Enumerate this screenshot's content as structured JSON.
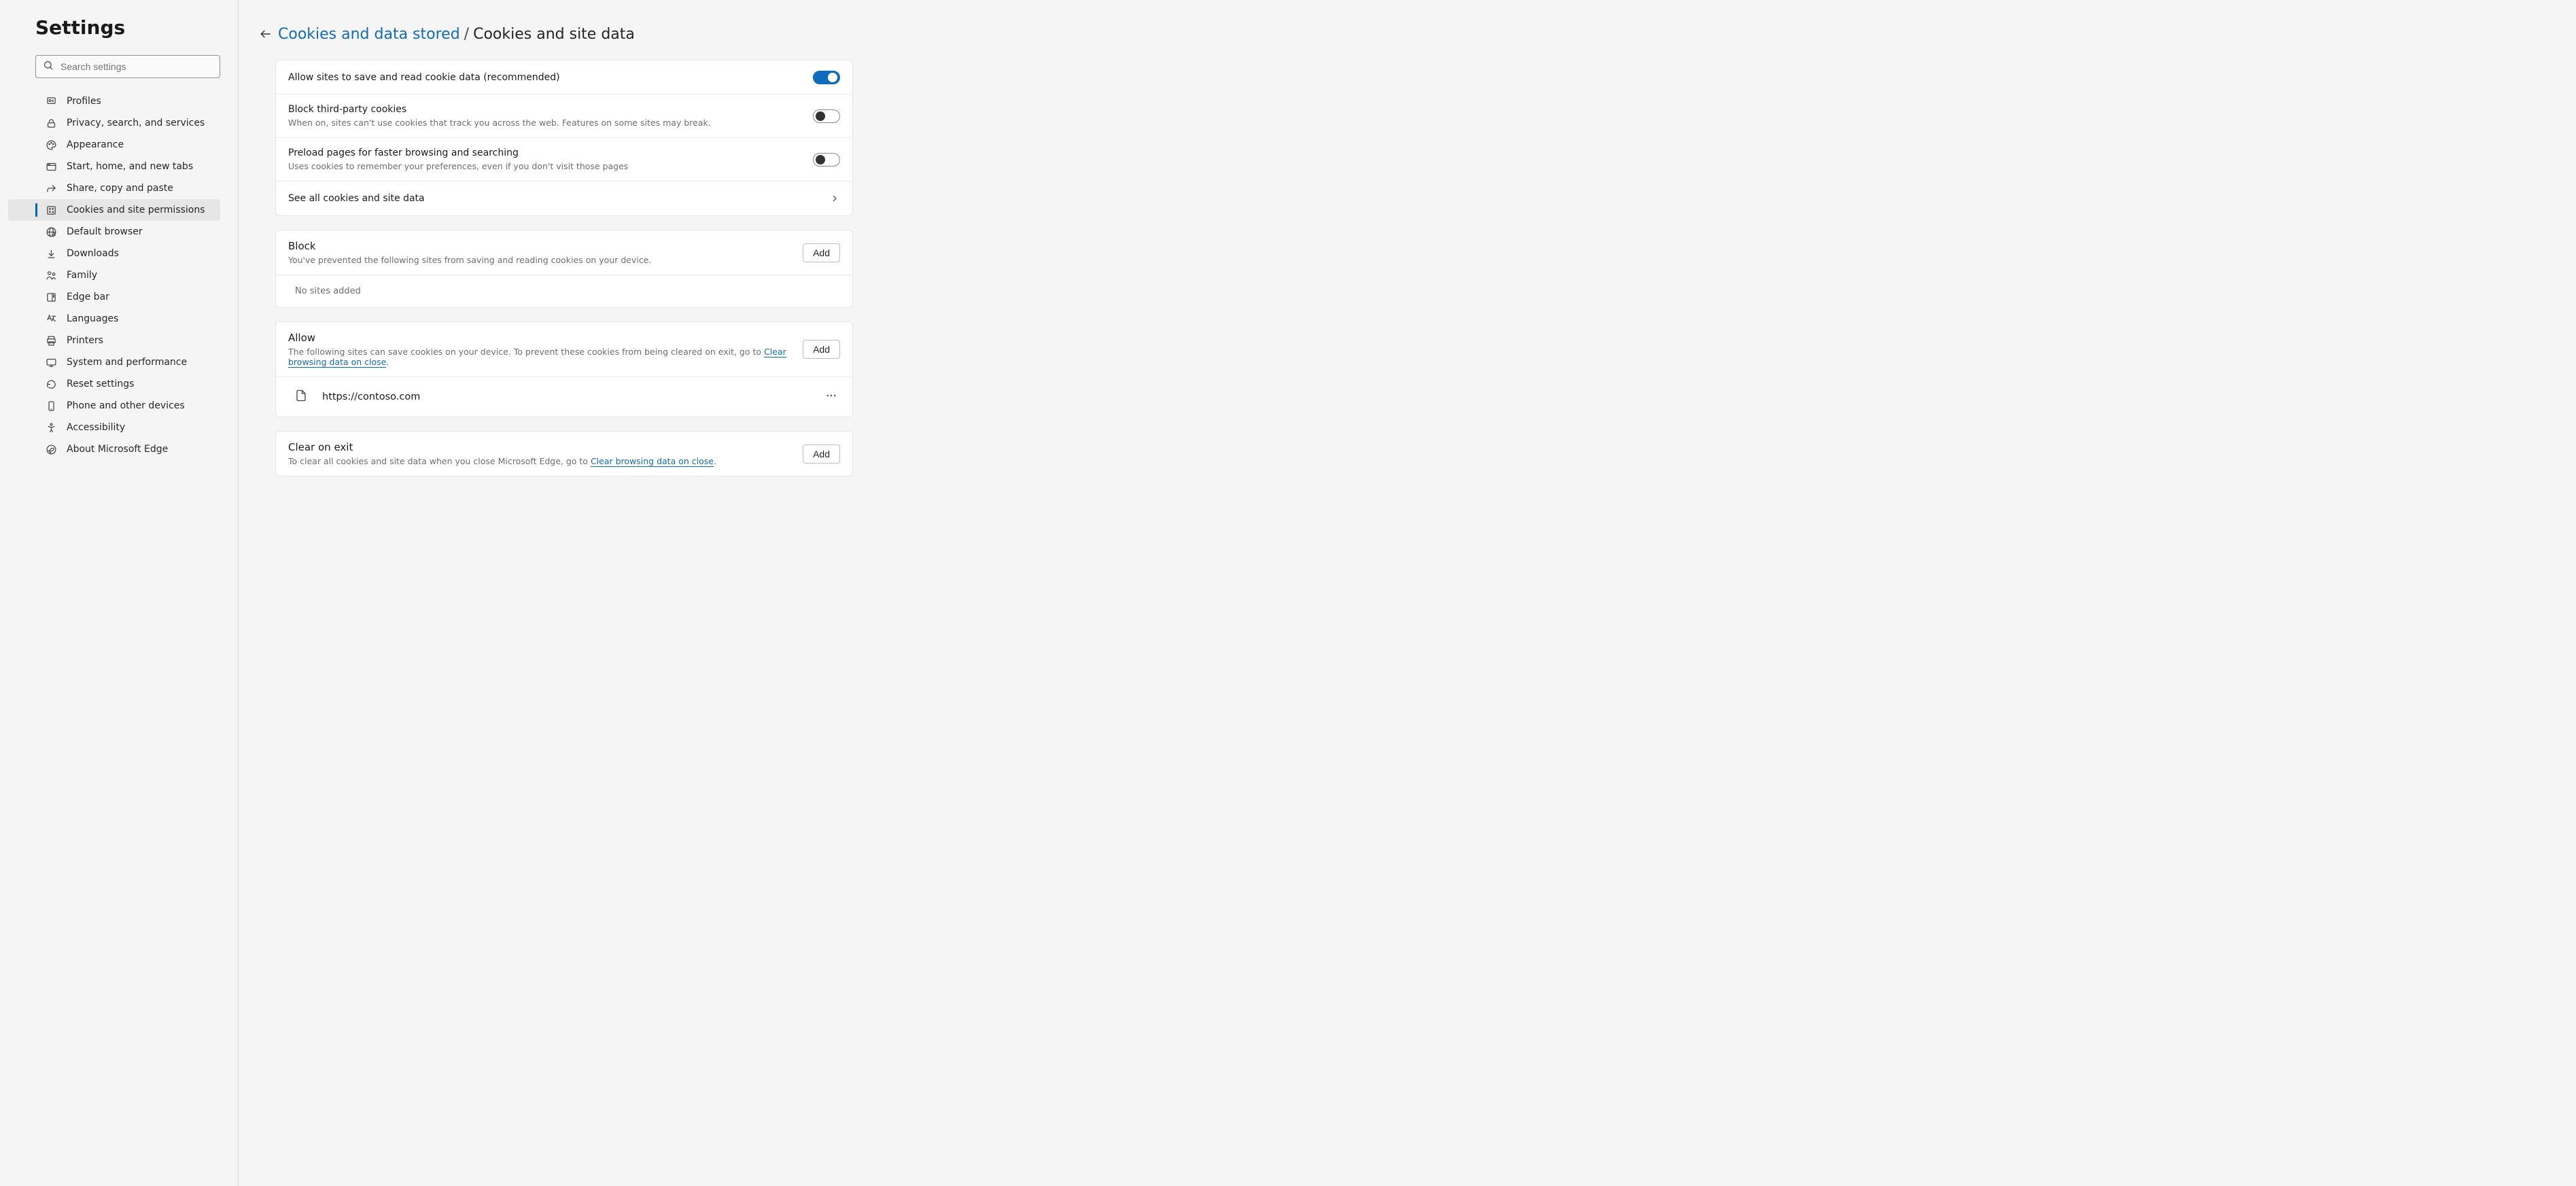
{
  "sidebar": {
    "title": "Settings",
    "search_placeholder": "Search settings",
    "items": [
      {
        "label": "Profiles",
        "icon": "person"
      },
      {
        "label": "Privacy, search, and services",
        "icon": "lock"
      },
      {
        "label": "Appearance",
        "icon": "palette"
      },
      {
        "label": "Start, home, and new tabs",
        "icon": "window"
      },
      {
        "label": "Share, copy and paste",
        "icon": "share"
      },
      {
        "label": "Cookies and site permissions",
        "icon": "cookie",
        "active": true
      },
      {
        "label": "Default browser",
        "icon": "globe"
      },
      {
        "label": "Downloads",
        "icon": "download"
      },
      {
        "label": "Family",
        "icon": "family"
      },
      {
        "label": "Edge bar",
        "icon": "sidebar"
      },
      {
        "label": "Languages",
        "icon": "languages"
      },
      {
        "label": "Printers",
        "icon": "printer"
      },
      {
        "label": "System and performance",
        "icon": "system"
      },
      {
        "label": "Reset settings",
        "icon": "reset"
      },
      {
        "label": "Phone and other devices",
        "icon": "phone"
      },
      {
        "label": "Accessibility",
        "icon": "accessibility"
      },
      {
        "label": "About Microsoft Edge",
        "icon": "edge"
      }
    ]
  },
  "breadcrumb": {
    "link": "Cookies and data stored",
    "current": "Cookies and site data"
  },
  "settings_card": {
    "allow_cookies": {
      "title": "Allow sites to save and read cookie data (recommended)",
      "on": true
    },
    "block_third_party": {
      "title": "Block third-party cookies",
      "sub": "When on, sites can't use cookies that track you across the web. Features on some sites may break.",
      "on": false
    },
    "preload": {
      "title": "Preload pages for faster browsing and searching",
      "sub": "Uses cookies to remember your preferences, even if you don't visit those pages",
      "on": false
    },
    "see_all": "See all cookies and site data"
  },
  "block_card": {
    "title": "Block",
    "sub": "You've prevented the following sites from saving and reading cookies on your device.",
    "add": "Add",
    "empty": "No sites added"
  },
  "allow_card": {
    "title": "Allow",
    "sub_prefix": "The following sites can save cookies on your device. To prevent these cookies from being cleared on exit, go to ",
    "sub_link": "Clear browsing data on close",
    "sub_suffix": ".",
    "add": "Add",
    "sites": [
      {
        "url": "https://contoso.com"
      }
    ]
  },
  "clear_card": {
    "title": "Clear on exit",
    "sub_prefix": "To clear all cookies and site data when you close Microsoft Edge, go to ",
    "sub_link": "Clear browsing data on close",
    "sub_suffix": ".",
    "add": "Add"
  }
}
